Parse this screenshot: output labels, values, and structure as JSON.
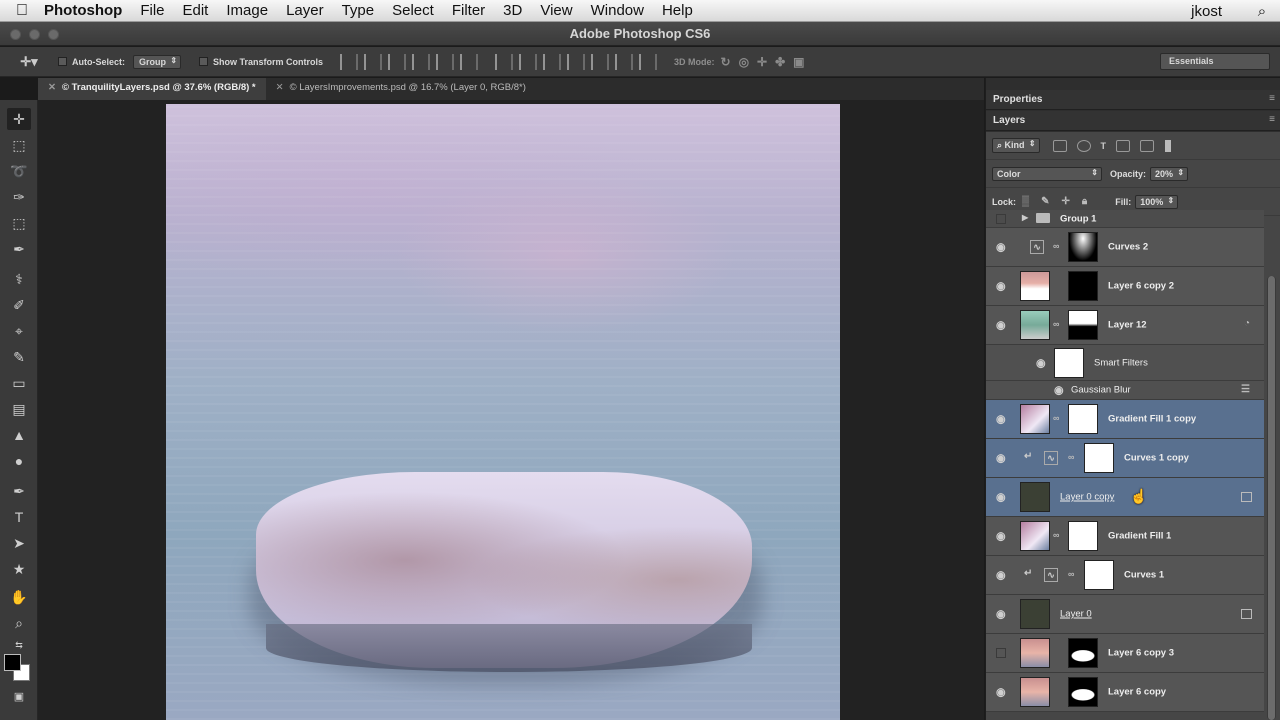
{
  "menubar": {
    "apple": "",
    "app": "Photoshop",
    "items": [
      "File",
      "Edit",
      "Image",
      "Layer",
      "Type",
      "Select",
      "Filter",
      "3D",
      "View",
      "Window",
      "Help"
    ],
    "user": "jkost"
  },
  "window": {
    "title": "Adobe Photoshop CS6"
  },
  "options": {
    "auto_select_label": "Auto-Select:",
    "auto_select_value": "Group",
    "transform_label": "Show Transform Controls",
    "mode_3d_label": "3D Mode:",
    "workspace": "Essentials"
  },
  "doctabs": [
    {
      "label": "© TranquilityLayers.psd @ 37.6% (RGB/8) *",
      "active": true
    },
    {
      "label": "© LayersImprovements.psd @ 16.7% (Layer 0, RGB/8*)",
      "active": false
    }
  ],
  "panels": {
    "properties": "Properties",
    "layers": "Layers",
    "kind": "Kind",
    "blend_mode": "Color",
    "opacity_label": "Opacity:",
    "opacity_value": "20%",
    "lock_label": "Lock:",
    "fill_label": "Fill:",
    "fill_value": "100%"
  },
  "layers": [
    {
      "name": "Group 1"
    },
    {
      "name": "Curves 2"
    },
    {
      "name": "Layer 6 copy 2"
    },
    {
      "name": "Layer 12"
    },
    {
      "name": "Smart Filters"
    },
    {
      "name": "Gaussian Blur"
    },
    {
      "name": "Gradient Fill 1 copy"
    },
    {
      "name": "Curves 1 copy"
    },
    {
      "name": "Layer 0 copy"
    },
    {
      "name": "Gradient Fill 1"
    },
    {
      "name": "Curves 1"
    },
    {
      "name": "Layer 0"
    },
    {
      "name": "Layer 6 copy 3"
    },
    {
      "name": "Layer 6 copy"
    }
  ],
  "icons": {
    "apple": "apple-icon",
    "search": "search-icon",
    "eye": "eye-icon",
    "link": "chain-link-icon",
    "curves": "curves-adjustment-icon",
    "folder": "folder-icon"
  }
}
